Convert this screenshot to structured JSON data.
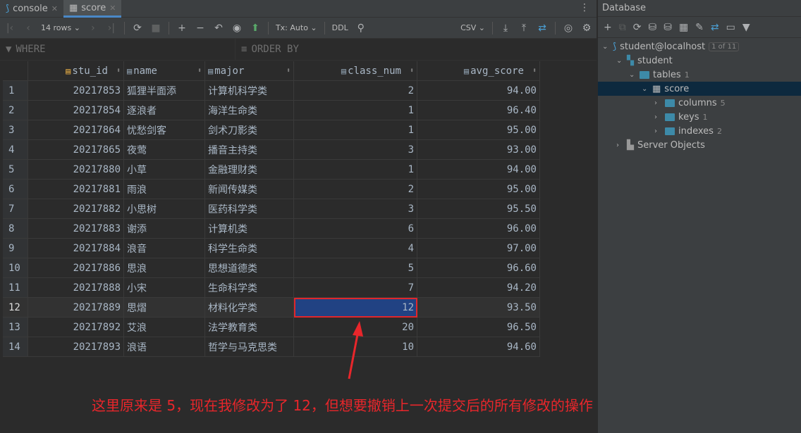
{
  "tabs": [
    {
      "label": "console",
      "icon": "mysql-icon"
    },
    {
      "label": "score",
      "icon": "table-icon"
    }
  ],
  "toolbar": {
    "rows": "14 rows",
    "tx": "Tx: Auto",
    "ddl": "DDL",
    "csv": "CSV"
  },
  "filter": {
    "where": "WHERE",
    "order_by": "ORDER BY"
  },
  "columns": [
    "stu_id",
    "name",
    "major",
    "class_num",
    "avg_score"
  ],
  "rows": [
    [
      "1",
      "20217853",
      "狐狸半面添",
      "计算机科学类",
      "2",
      "94.00"
    ],
    [
      "2",
      "20217854",
      "逐浪者",
      "海洋生命类",
      "1",
      "96.40"
    ],
    [
      "3",
      "20217864",
      "忧愁剑客",
      "剑术刀影类",
      "1",
      "95.00"
    ],
    [
      "4",
      "20217865",
      "夜莺",
      "播音主持类",
      "3",
      "93.00"
    ],
    [
      "5",
      "20217880",
      "小草",
      "金融理财类",
      "1",
      "94.00"
    ],
    [
      "6",
      "20217881",
      "雨浪",
      "新闻传媒类",
      "2",
      "95.00"
    ],
    [
      "7",
      "20217882",
      "小思树",
      "医药科学类",
      "3",
      "95.50"
    ],
    [
      "8",
      "20217883",
      "谢添",
      "计算机类",
      "6",
      "96.00"
    ],
    [
      "9",
      "20217884",
      "浪音",
      "科学生命类",
      "4",
      "97.00"
    ],
    [
      "10",
      "20217886",
      "思浪",
      "思想道德类",
      "5",
      "96.60"
    ],
    [
      "11",
      "20217888",
      "小宋",
      "生命科学类",
      "7",
      "94.20"
    ],
    [
      "12",
      "20217889",
      "思熠",
      "材料化学类",
      "12",
      "93.50"
    ],
    [
      "13",
      "20217892",
      "艾浪",
      "法学教育类",
      "20",
      "96.50"
    ],
    [
      "14",
      "20217893",
      "浪语",
      "哲学与马克思类",
      "10",
      "94.60"
    ]
  ],
  "selected_row": "12",
  "database": {
    "title": "Database",
    "connection": "student@localhost",
    "conn_badge": "1 of 11",
    "schema": "student",
    "tables": "tables",
    "tables_count": "1",
    "table": "score",
    "columns": "columns",
    "columns_count": "5",
    "keys": "keys",
    "keys_count": "1",
    "indexes": "indexes",
    "indexes_count": "2",
    "server_objects": "Server Objects"
  },
  "annotation": "这里原来是 5，现在我修改为了 12，但想要撤销上一次提交后的所有修改的操作",
  "colors": {
    "annotation": "#e8262b",
    "selection": "#214283",
    "accent": "#4a88c7"
  }
}
